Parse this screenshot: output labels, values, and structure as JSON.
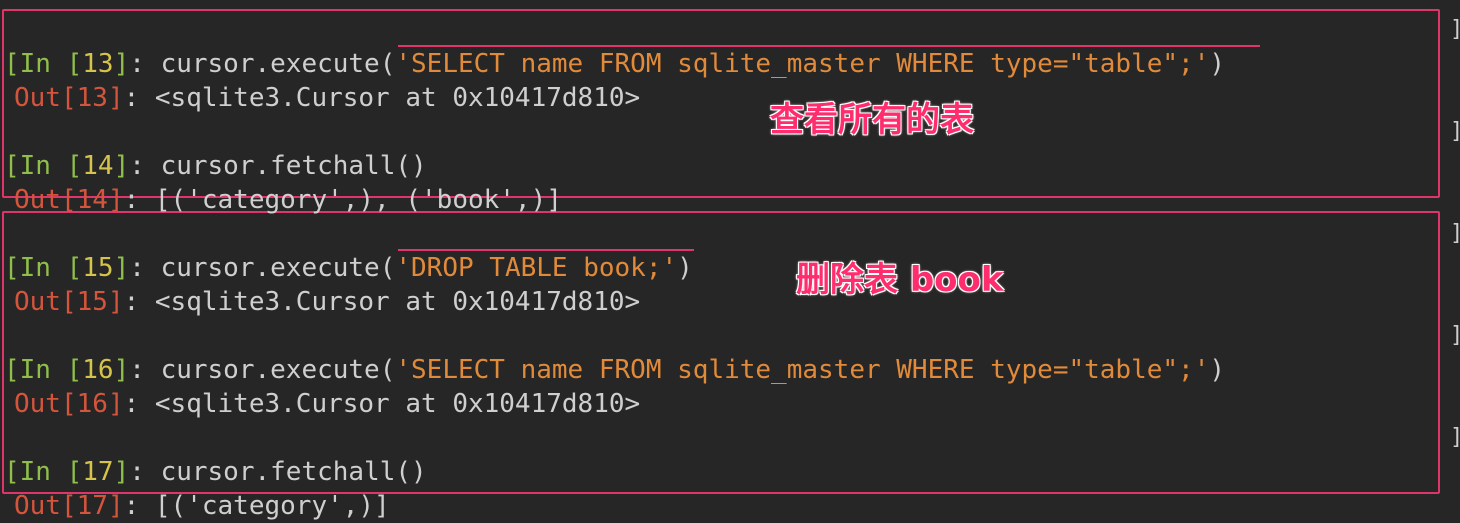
{
  "cells": [
    {
      "in_label": "In",
      "in_num": "13",
      "code_prefix": "cursor.execute(",
      "code_string": "'SELECT name FROM sqlite_master WHERE type=\"table\";'",
      "code_suffix": ")",
      "out_label": "Out",
      "out_num": "13",
      "output": "<sqlite3.Cursor at 0x10417d810>"
    },
    {
      "in_label": "In",
      "in_num": "14",
      "code_prefix": "cursor.fetchall()",
      "code_string": "",
      "code_suffix": "",
      "out_label": "Out",
      "out_num": "14",
      "output": "[('category',), ('book',)]"
    },
    {
      "in_label": "In",
      "in_num": "15",
      "code_prefix": "cursor.execute(",
      "code_string": "'DROP TABLE book;'",
      "code_suffix": ")",
      "out_label": "Out",
      "out_num": "15",
      "output": "<sqlite3.Cursor at 0x10417d810>"
    },
    {
      "in_label": "In",
      "in_num": "16",
      "code_prefix": "cursor.execute(",
      "code_string": "'SELECT name FROM sqlite_master WHERE type=\"table\";'",
      "code_suffix": ")",
      "out_label": "Out",
      "out_num": "16",
      "output": "<sqlite3.Cursor at 0x10417d810>"
    },
    {
      "in_label": "In",
      "in_num": "17",
      "code_prefix": "cursor.fetchall()",
      "code_string": "",
      "code_suffix": "",
      "out_label": "Out",
      "out_num": "17",
      "output": "[('category',)]"
    }
  ],
  "annotations": {
    "view_all_tables": "查看所有的表",
    "drop_table_book": "删除表 book"
  },
  "colors": {
    "background": "#262626",
    "prompt_in": "#8fbf4a",
    "prompt_num_in": "#d6c44a",
    "prompt_out": "#d4553c",
    "string": "#e08a3a",
    "annotation": "#ff2d6e",
    "highlight_border": "#e0356a"
  }
}
